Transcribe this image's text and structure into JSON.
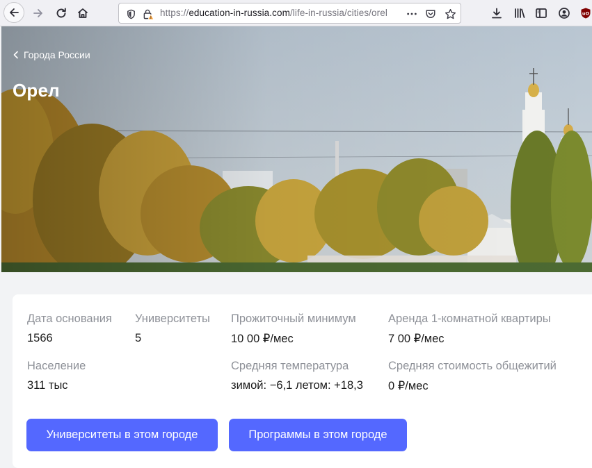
{
  "browser": {
    "url_prefix": "https://",
    "url_domain": "education-in-russia.com",
    "url_path": "/life-in-russia/cities/orel",
    "icons": [
      "back-arrow-icon",
      "forward-arrow-icon",
      "reload-icon",
      "home-icon",
      "shield-icon",
      "lock-warning-icon",
      "more-icon",
      "pocket-icon",
      "bookmark-star-icon",
      "download-icon",
      "library-icon",
      "sidebar-icon",
      "account-icon",
      "ublock-icon"
    ]
  },
  "hero": {
    "back_label": "Города России",
    "title": "Орел"
  },
  "info": {
    "founded_label": "Дата основания",
    "founded_value": "1566",
    "universities_label": "Университеты",
    "universities_value": "5",
    "living_label": "Прожиточный минимум",
    "living_value": "10 00 ₽/мес",
    "rent_label": "Аренда 1-комнатной квартиры",
    "rent_value": "7 00 ₽/мес",
    "population_label": "Население",
    "population_value": "311 тыс",
    "temperature_label": "Средняя температура",
    "temperature_value": "зимой: −6,1 летом: +18,3",
    "dorm_label": "Средняя стоимость общежитий",
    "dorm_value": "0 ₽/мес"
  },
  "actions": {
    "universities_button": "Университеты в этом городе",
    "programs_button": "Программы в этом городе"
  },
  "colors": {
    "accent": "#5468ff",
    "label": "#8e9198",
    "value": "#1a1a1a",
    "page_bg": "#f2f3f5"
  }
}
